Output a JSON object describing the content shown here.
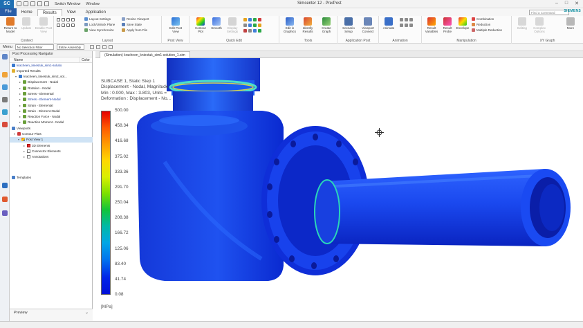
{
  "app": {
    "logo": "SC",
    "title": "Simcenter 12 - Pre/Post",
    "switch_window": "Switch Window",
    "window_menu": "Window",
    "brand": "SIEMENS",
    "search_placeholder": "Find a Command"
  },
  "tabs": [
    {
      "label": "File"
    },
    {
      "label": "Home"
    },
    {
      "label": "Results"
    },
    {
      "label": "View"
    },
    {
      "label": "Application"
    }
  ],
  "ribbon": {
    "context": {
      "label": "Context",
      "buttons": [
        "Return to Model",
        "Update",
        "Enable Post View"
      ]
    },
    "layout": {
      "label": "Layout",
      "items": [
        "Layout Settings",
        "Lock/Unlock Plane",
        "View Synchronize",
        "Resize Viewport",
        "Save State",
        "Apply from File"
      ]
    },
    "post_view": {
      "label": "Post View",
      "buttons": [
        "Edit Post View"
      ]
    },
    "quick_edit": {
      "label": "Quick Edit",
      "buttons": [
        "Contour Plot",
        "Smooth",
        "Display Settings"
      ]
    },
    "tools": {
      "label": "Tools",
      "buttons": [
        "Edit in Graphics",
        "Identify Results",
        "Create Graph"
      ]
    },
    "app_post": {
      "label": "Application Post",
      "buttons": [
        "Scenario Setup",
        "Viewport Connect"
      ]
    },
    "animation": {
      "label": "Animation",
      "buttons": [
        "Animate"
      ]
    },
    "manipulation": {
      "label": "Manipulation",
      "buttons": [
        "Result Variables",
        "Result Probe",
        "Envelope"
      ],
      "items": [
        "Combination",
        "Reduction",
        "Multiple Reduction"
      ]
    },
    "xy_graph": {
      "label": "XY Graph",
      "buttons": [
        "Editing",
        "Complex Options",
        "More"
      ]
    }
  },
  "selection_bar": {
    "menu": "Menu",
    "filter": "No Selection Filter",
    "scope": "Entire Assembly"
  },
  "navigator": {
    "title": "Post Processing Navigator",
    "columns": [
      "Name",
      "Color"
    ],
    "rows": [
      {
        "label": "kracheen_kniestuk_sim1-solutio",
        "blue": true
      },
      {
        "label": "Imported Results"
      },
      {
        "label": "kracheen_kniestuk_sim2_sol..."
      },
      {
        "label": "Displacement - Nodal"
      },
      {
        "label": "Rotation - Nodal"
      },
      {
        "label": "Stress - Elemental"
      },
      {
        "label": "Stress - Element-Nodal",
        "blue": true
      },
      {
        "label": "Strain - Elemental"
      },
      {
        "label": "Strain - Element-Nodal"
      },
      {
        "label": "Reaction Force - Nodal"
      },
      {
        "label": "Reaction Moment - Nodal"
      },
      {
        "label": "Viewports"
      },
      {
        "label": "Contour Plots"
      },
      {
        "label": "Post View 1",
        "selected": true
      },
      {
        "label": "3D Elements"
      },
      {
        "label": "Connector Elements"
      },
      {
        "label": "Annotations"
      },
      {
        "label": "Templates"
      }
    ],
    "preview_label": "Preview"
  },
  "graphics": {
    "tab_label": "(Simulation) kracheen_kniestuk_sim1-solution_1.sim",
    "info_lines": [
      "SUBCASE 1, Static Step 1",
      "Displacement - Nodal, Magnitude",
      "Min : 0.000, Max : 3.803, Units = ",
      "Deformation : Displacement - No..."
    ],
    "legend_values": [
      "500.00",
      "458.34",
      "416.68",
      "375.02",
      "333.36",
      "291.70",
      "250.04",
      "208.38",
      "166.72",
      "125.06",
      "83.40",
      "41.74",
      "0.08"
    ],
    "units": "[MPa]"
  },
  "colors": {
    "file_tab": "#2a5ea8",
    "selection": "#cfe3f5",
    "brand": "#0a8ea0",
    "mesh_blue": "#0a2ee6"
  }
}
